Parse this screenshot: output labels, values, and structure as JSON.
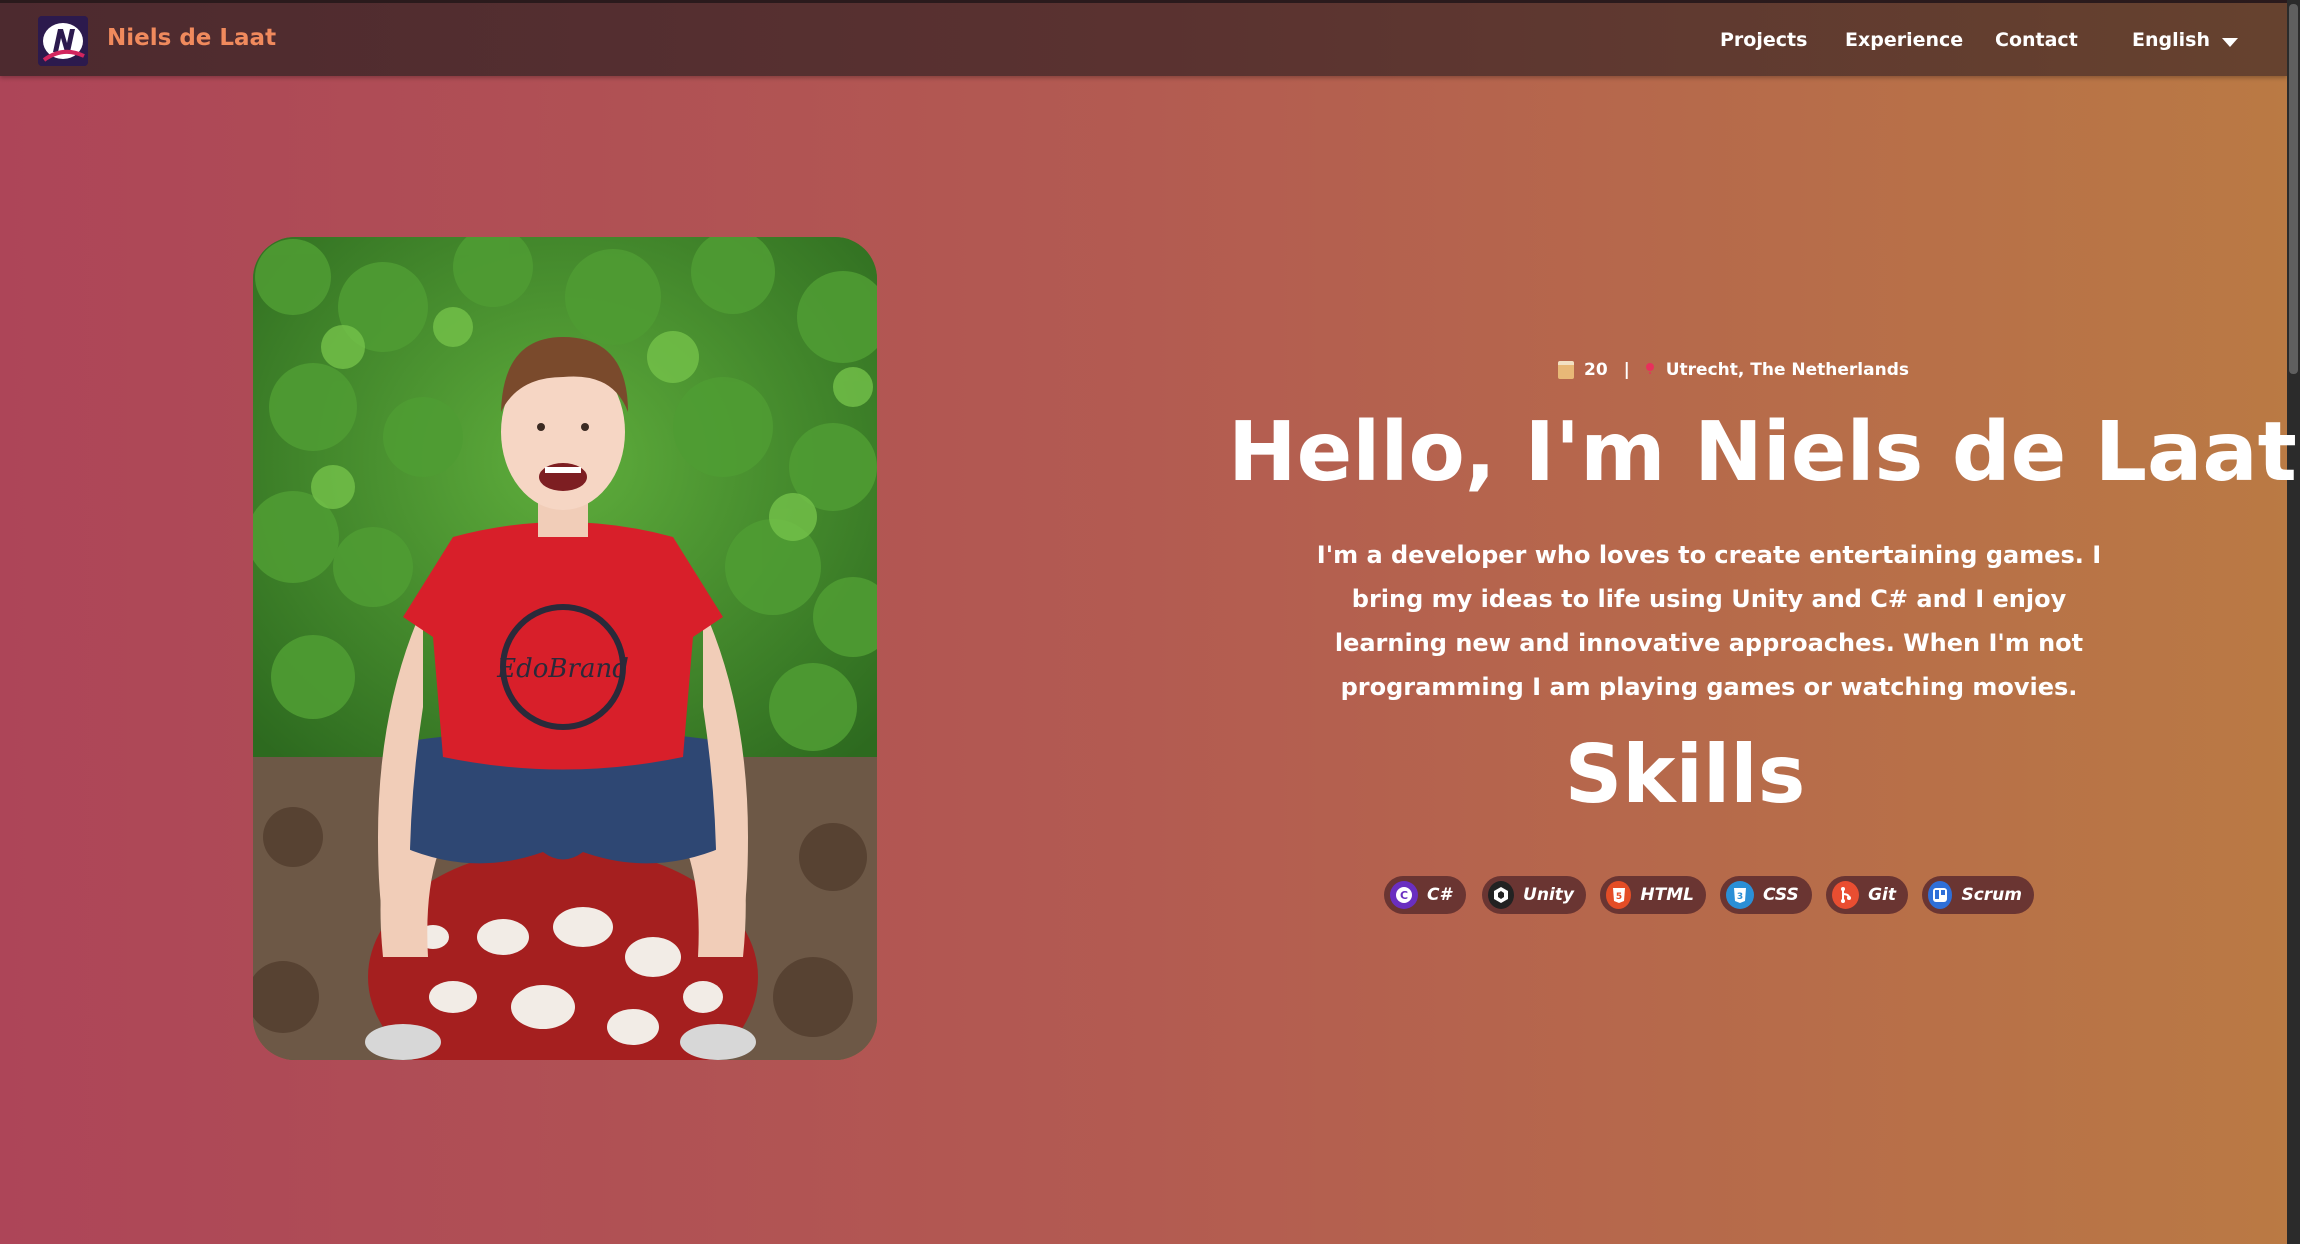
{
  "navbar": {
    "brand": "Niels de Laat",
    "links": [
      "Projects",
      "Experience",
      "Contact"
    ],
    "language": "English"
  },
  "intro": {
    "age": "20",
    "separator": "|",
    "location": "Utrecht, The Netherlands",
    "headline": "Hello, I'm Niels de Laat",
    "bio": "I'm a developer who loves to create entertaining games. I bring my ideas to life using Unity and C# and I enjoy learning new and innovative approaches. When I'm not programming I am playing games or watching movies."
  },
  "skills": {
    "title": "Skills",
    "items": [
      {
        "label": "C#",
        "icon": "csharp-icon",
        "color": "#6a2fc0"
      },
      {
        "label": "Unity",
        "icon": "unity-icon",
        "color": "#222222"
      },
      {
        "label": "HTML",
        "icon": "html5-icon",
        "color": "#e44d26"
      },
      {
        "label": "CSS",
        "icon": "css3-icon",
        "color": "#2b8fd6"
      },
      {
        "label": "Git",
        "icon": "git-icon",
        "color": "#e94e31"
      },
      {
        "label": "Scrum",
        "icon": "trello-icon",
        "color": "#2f6fd8"
      }
    ]
  }
}
